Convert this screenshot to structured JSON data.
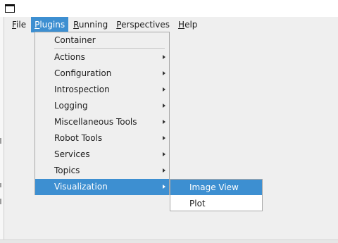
{
  "menubar": {
    "file": {
      "first": "F",
      "rest": "ile"
    },
    "plugins": {
      "first": "P",
      "rest": "lugins"
    },
    "running": {
      "first": "R",
      "rest": "unning"
    },
    "perspectives": {
      "first": "P",
      "rest": "erspectives"
    },
    "help": {
      "first": "H",
      "rest": "elp"
    }
  },
  "plugins_menu": {
    "items": [
      {
        "label": "Container"
      },
      {
        "label": "Actions"
      },
      {
        "label": "Configuration"
      },
      {
        "label": "Introspection"
      },
      {
        "label": "Logging"
      },
      {
        "label": "Miscellaneous Tools"
      },
      {
        "label": "Robot Tools"
      },
      {
        "label": "Services"
      },
      {
        "label": "Topics"
      },
      {
        "label": "Visualization"
      }
    ]
  },
  "visualization_menu": {
    "items": [
      {
        "label": "Image View"
      },
      {
        "label": "Plot"
      }
    ]
  },
  "colors": {
    "highlight": "#3d8fd1",
    "menu_background": "#efefef",
    "submenu_background": "#ffffff",
    "text": "#1e1e1e"
  },
  "icons": [
    "window-icon",
    "submenu-arrow-icon"
  ]
}
